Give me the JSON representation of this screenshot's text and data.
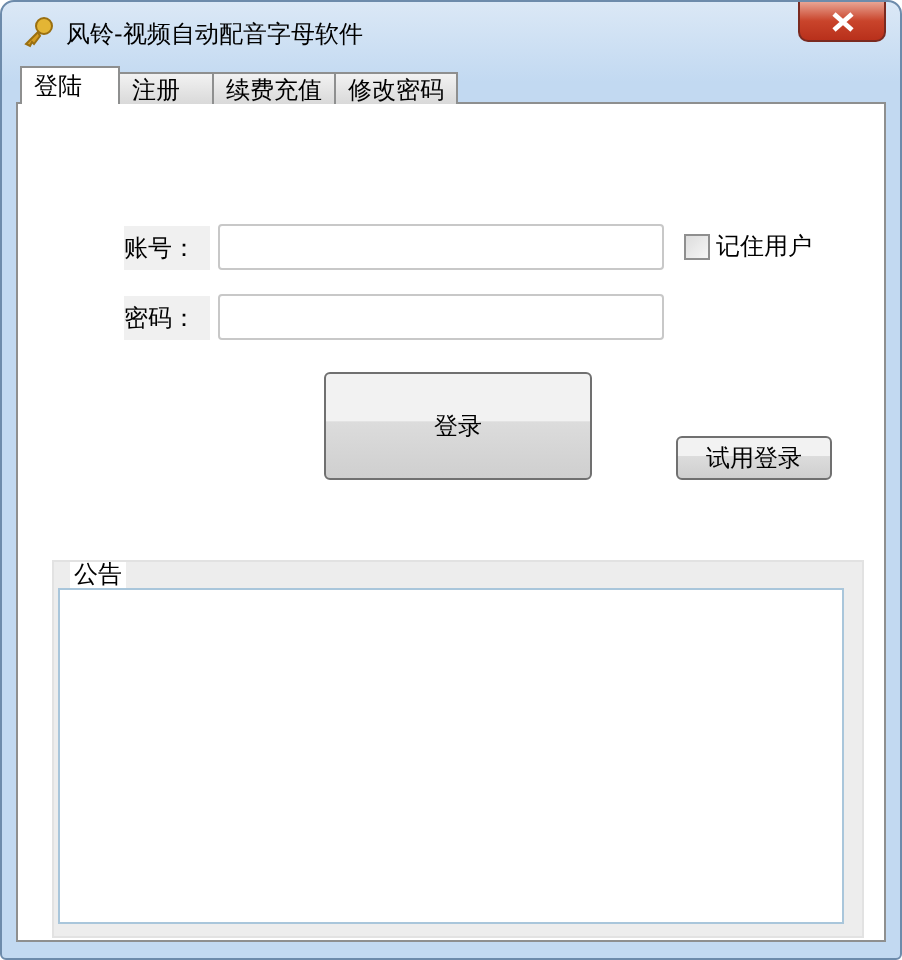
{
  "window": {
    "title": "风铃-视频自动配音字母软件"
  },
  "tabs": [
    {
      "label": "登陆",
      "selected": true
    },
    {
      "label": "注册",
      "selected": false
    },
    {
      "label": "续费充值",
      "selected": false
    },
    {
      "label": "修改密码",
      "selected": false
    }
  ],
  "form": {
    "fields": [
      {
        "label": "账号："
      },
      {
        "label": "密码："
      }
    ],
    "remember": {
      "label": "记住用户",
      "checked": false
    },
    "login_button": "登录",
    "trial_button": "试用登录"
  },
  "notice": {
    "title": "公告"
  }
}
